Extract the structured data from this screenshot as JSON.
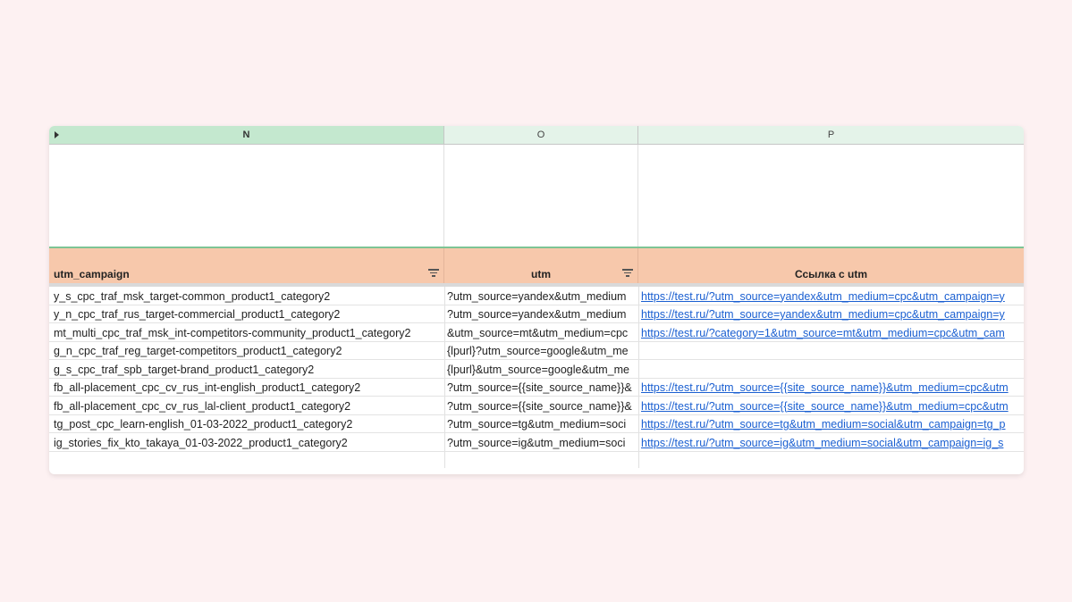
{
  "columns": {
    "n": "N",
    "o": "O",
    "p": "P"
  },
  "headers": {
    "n": "utm_campaign",
    "o": "utm",
    "p": "Ссылка с utm"
  },
  "rows": [
    {
      "campaign": "y_s_cpc_traf_msk_target-common_product1_category2",
      "utm": "?utm_source=yandex&utm_medium",
      "link": "https://test.ru/?utm_source=yandex&utm_medium=cpc&utm_campaign=y"
    },
    {
      "campaign": "y_n_cpc_traf_rus_target-commercial_product1_category2",
      "utm": "?utm_source=yandex&utm_medium",
      "link": "https://test.ru/?utm_source=yandex&utm_medium=cpc&utm_campaign=y"
    },
    {
      "campaign": "mt_multi_cpc_traf_msk_int-competitors-community_product1_category2",
      "utm": "&utm_source=mt&utm_medium=cpc",
      "link": "https://test.ru/?category=1&utm_source=mt&utm_medium=cpc&utm_cam"
    },
    {
      "campaign": "g_n_cpc_traf_reg_target-competitors_product1_category2",
      "utm": "{lpurl}?utm_source=google&utm_me",
      "link": ""
    },
    {
      "campaign": "g_s_cpc_traf_spb_target-brand_product1_category2",
      "utm": "{lpurl}&utm_source=google&utm_me",
      "link": ""
    },
    {
      "campaign": "fb_all-placement_cpc_cv_rus_int-english_product1_category2",
      "utm": "?utm_source={{site_source_name}}&",
      "link": "https://test.ru/?utm_source={{site_source_name}}&utm_medium=cpc&utm"
    },
    {
      "campaign": "fb_all-placement_cpc_cv_rus_lal-client_product1_category2",
      "utm": "?utm_source={{site_source_name}}&",
      "link": "https://test.ru/?utm_source={{site_source_name}}&utm_medium=cpc&utm"
    },
    {
      "campaign": "tg_post_cpc_learn-english_01-03-2022_product1_category2",
      "utm": "?utm_source=tg&utm_medium=soci",
      "link": "https://test.ru/?utm_source=tg&utm_medium=social&utm_campaign=tg_p"
    },
    {
      "campaign": "ig_stories_fix_kto_takaya_01-03-2022_product1_category2",
      "utm": "?utm_source=ig&utm_medium=soci",
      "link": "https://test.ru/?utm_source=ig&utm_medium=social&utm_campaign=ig_s"
    }
  ]
}
